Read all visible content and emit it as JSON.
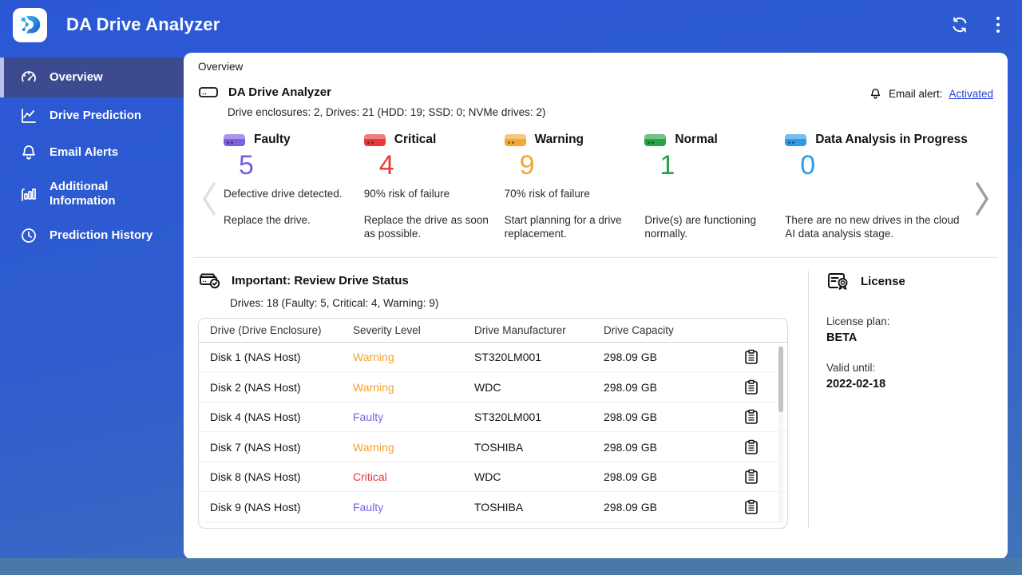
{
  "topbar": {
    "app_title": "DA Drive Analyzer",
    "icons": [
      "app-logo",
      "refresh-icon",
      "kebab-menu-icon"
    ]
  },
  "sidebar": {
    "items": [
      {
        "label": "Overview",
        "icon": "gauge-icon",
        "active": true
      },
      {
        "label": "Drive Prediction",
        "icon": "line-chart-icon",
        "active": false
      },
      {
        "label": "Email Alerts",
        "icon": "bell-icon",
        "active": false
      },
      {
        "label": "Additional Information",
        "icon": "bar-chart-icon",
        "active": false
      },
      {
        "label": "Prediction History",
        "icon": "clock-icon",
        "active": false
      }
    ]
  },
  "content": {
    "tab_label": "Overview",
    "header": {
      "title": "DA Drive Analyzer",
      "subtitle": "Drive enclosures: 2, Drives: 21 (HDD: 19; SSD: 0; NVMe drives: 2)",
      "icon": "drive-icon"
    },
    "email_alert": {
      "label": "Email alert:",
      "link": "Activated",
      "icon": "bell-icon"
    },
    "carousel": {
      "prev_icon": "chevron-left-icon",
      "next_icon": "chevron-right-icon"
    },
    "cards": [
      {
        "title": "Faulty",
        "count": "5",
        "color": "#7b5fe0",
        "desc1": "Defective drive detected.",
        "desc2": "Replace the drive."
      },
      {
        "title": "Critical",
        "count": "4",
        "color": "#e8383f",
        "desc1": "90% risk of failure",
        "desc2": "Replace the drive as soon as possible."
      },
      {
        "title": "Warning",
        "count": "9",
        "color": "#f2a933",
        "desc1": "70% risk of failure",
        "desc2": "Start planning for a drive replacement."
      },
      {
        "title": "Normal",
        "count": "1",
        "color": "#27a346",
        "desc1": "",
        "desc2": "Drive(s) are functioning normally."
      },
      {
        "title": "Data Analysis in Progress",
        "count": "0",
        "color": "#2d9ce8",
        "desc1": "",
        "desc2": "There are no new drives in the cloud AI data analysis stage."
      }
    ],
    "review": {
      "title": "Important: Review Drive Status",
      "subtitle": "Drives: 18 (Faulty: 5, Critical: 4, Warning: 9)",
      "icon": "drive-check-icon"
    },
    "table": {
      "columns": [
        "Drive (Drive Enclosure)",
        "Severity Level",
        "Drive Manufacturer",
        "Drive Capacity"
      ],
      "row_action_icon": "clipboard-icon",
      "rows": [
        {
          "drive": "Disk 1 (NAS Host)",
          "severity": "Warning",
          "severity_color": "#f0a132",
          "manufacturer": "ST320LM001",
          "capacity": "298.09 GB"
        },
        {
          "drive": "Disk 2 (NAS Host)",
          "severity": "Warning",
          "severity_color": "#f0a132",
          "manufacturer": "WDC",
          "capacity": "298.09 GB"
        },
        {
          "drive": "Disk 4 (NAS Host)",
          "severity": "Faulty",
          "severity_color": "#7b5fe0",
          "manufacturer": "ST320LM001",
          "capacity": "298.09 GB"
        },
        {
          "drive": "Disk 7 (NAS Host)",
          "severity": "Warning",
          "severity_color": "#f0a132",
          "manufacturer": "TOSHIBA",
          "capacity": "298.09 GB"
        },
        {
          "drive": "Disk 8 (NAS Host)",
          "severity": "Critical",
          "severity_color": "#e8383f",
          "manufacturer": "WDC",
          "capacity": "298.09 GB"
        },
        {
          "drive": "Disk 9 (NAS Host)",
          "severity": "Faulty",
          "severity_color": "#7b5fe0",
          "manufacturer": "TOSHIBA",
          "capacity": "298.09 GB"
        }
      ]
    },
    "license": {
      "title": "License",
      "icon": "certificate-icon",
      "plan_label": "License plan:",
      "plan": "BETA",
      "valid_label": "Valid until:",
      "valid": "2022-02-18"
    }
  },
  "colors": {
    "topbar_blue": "#2b57d5",
    "sidebar_active": "#3c4a90",
    "faulty": "#7b5fe0",
    "critical": "#e8383f",
    "warning": "#f0a132",
    "normal": "#27a346",
    "analysis": "#2d9ce8",
    "link": "#2742d8",
    "desktop_strip": "#4a79a8"
  }
}
